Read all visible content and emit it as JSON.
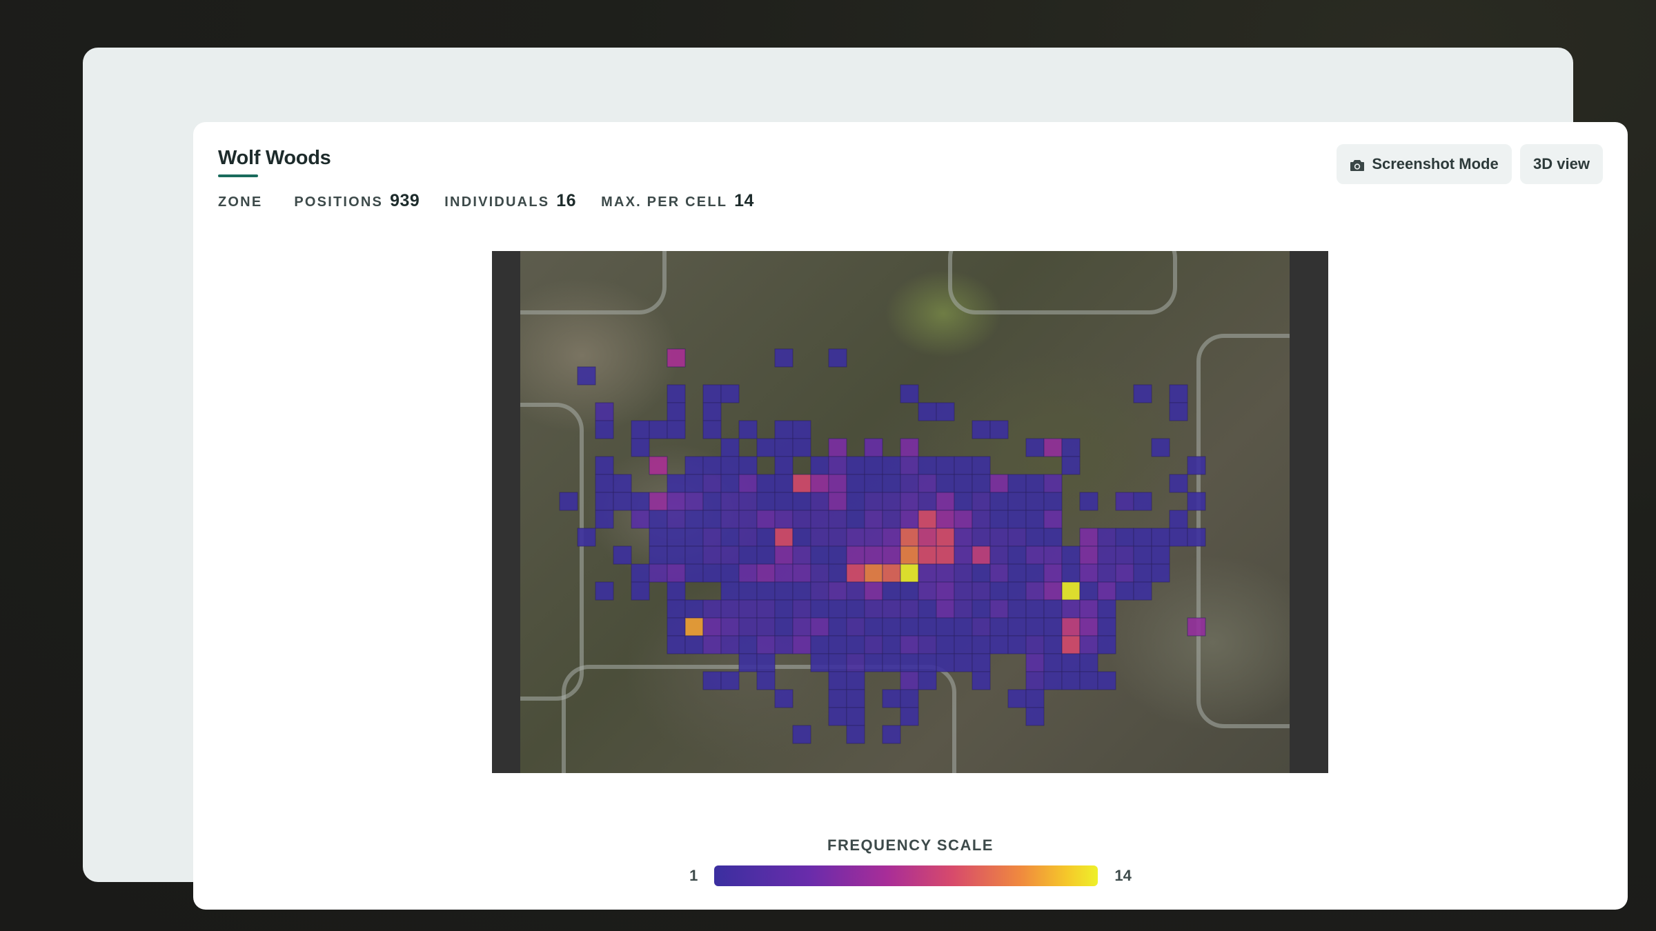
{
  "header": {
    "title": "Wolf Woods",
    "stats": [
      {
        "label": "ZONE",
        "value": ""
      },
      {
        "label": "POSITIONS",
        "value": "939"
      },
      {
        "label": "INDIVIDUALS",
        "value": "16"
      },
      {
        "label": "MAX. PER CELL",
        "value": "14"
      }
    ]
  },
  "toolbar": {
    "screenshot_label": "Screenshot Mode",
    "screenshot_icon": "camera-icon",
    "view3d_label": "3D view"
  },
  "heatmap": {
    "color_min": "#3b2fa0",
    "color_max": "#eef02a",
    "max_value": 14,
    "cells": [
      [
        0,
        0,
        0,
        0,
        0,
        0,
        0,
        0,
        0,
        0,
        0,
        0,
        0,
        0,
        0,
        0,
        0,
        0,
        0,
        0,
        0,
        0,
        0,
        0,
        0,
        0,
        0,
        0,
        0,
        0,
        0,
        0,
        0,
        0,
        0,
        0,
        0,
        0
      ],
      [
        0,
        0,
        0,
        0,
        0,
        0,
        0,
        7,
        0,
        0,
        0,
        0,
        0,
        1,
        0,
        0,
        1,
        0,
        0,
        0,
        0,
        0,
        0,
        0,
        0,
        0,
        0,
        0,
        0,
        0,
        0,
        0,
        0,
        0,
        0,
        0,
        0,
        0
      ],
      [
        0,
        0,
        1,
        0,
        0,
        0,
        0,
        0,
        0,
        0,
        0,
        0,
        0,
        0,
        0,
        0,
        0,
        0,
        0,
        0,
        0,
        0,
        0,
        0,
        0,
        0,
        0,
        0,
        0,
        0,
        0,
        0,
        0,
        0,
        0,
        0,
        0,
        0
      ],
      [
        0,
        0,
        0,
        0,
        0,
        0,
        0,
        1,
        0,
        1,
        1,
        0,
        0,
        0,
        0,
        0,
        0,
        0,
        0,
        0,
        1,
        0,
        0,
        0,
        0,
        0,
        0,
        0,
        0,
        0,
        0,
        0,
        0,
        1,
        0,
        1,
        0,
        0
      ],
      [
        0,
        0,
        0,
        2,
        0,
        0,
        0,
        1,
        0,
        1,
        0,
        0,
        0,
        0,
        0,
        0,
        0,
        0,
        0,
        0,
        0,
        1,
        1,
        0,
        0,
        0,
        0,
        0,
        0,
        0,
        0,
        0,
        0,
        0,
        0,
        1,
        0,
        0
      ],
      [
        0,
        0,
        0,
        1,
        0,
        1,
        1,
        1,
        0,
        1,
        0,
        1,
        0,
        1,
        1,
        0,
        0,
        0,
        0,
        0,
        0,
        0,
        0,
        0,
        1,
        1,
        0,
        0,
        0,
        0,
        0,
        0,
        0,
        0,
        0,
        0,
        0,
        0
      ],
      [
        0,
        0,
        0,
        0,
        0,
        1,
        0,
        0,
        0,
        0,
        1,
        0,
        1,
        1,
        1,
        0,
        5,
        0,
        4,
        0,
        5,
        0,
        0,
        0,
        0,
        0,
        0,
        1,
        6,
        1,
        0,
        0,
        0,
        0,
        1,
        0,
        0,
        0
      ],
      [
        0,
        0,
        0,
        1,
        0,
        0,
        7,
        0,
        1,
        1,
        1,
        1,
        0,
        1,
        0,
        1,
        3,
        1,
        1,
        1,
        3,
        1,
        1,
        1,
        1,
        0,
        0,
        0,
        0,
        1,
        0,
        0,
        0,
        0,
        0,
        0,
        1,
        0
      ],
      [
        0,
        0,
        0,
        1,
        1,
        0,
        0,
        1,
        1,
        2,
        1,
        4,
        1,
        1,
        9,
        6,
        5,
        1,
        1,
        1,
        2,
        3,
        1,
        1,
        1,
        5,
        1,
        1,
        3,
        0,
        0,
        0,
        0,
        0,
        0,
        1,
        0,
        0
      ],
      [
        0,
        1,
        0,
        1,
        1,
        1,
        6,
        4,
        3,
        1,
        2,
        2,
        1,
        1,
        1,
        2,
        5,
        1,
        2,
        2,
        3,
        2,
        5,
        1,
        2,
        1,
        1,
        1,
        1,
        0,
        1,
        0,
        2,
        1,
        0,
        0,
        1,
        0
      ],
      [
        0,
        0,
        0,
        1,
        0,
        3,
        1,
        2,
        1,
        1,
        2,
        2,
        4,
        3,
        2,
        2,
        2,
        1,
        3,
        2,
        4,
        9,
        6,
        5,
        2,
        1,
        1,
        1,
        4,
        0,
        0,
        0,
        0,
        0,
        0,
        1,
        0,
        0
      ],
      [
        0,
        0,
        1,
        0,
        0,
        0,
        1,
        1,
        1,
        2,
        1,
        2,
        1,
        9,
        1,
        2,
        2,
        3,
        3,
        4,
        10,
        8,
        9,
        3,
        2,
        2,
        2,
        1,
        1,
        0,
        5,
        2,
        1,
        1,
        1,
        1,
        1,
        0
      ],
      [
        0,
        0,
        0,
        0,
        1,
        0,
        1,
        1,
        1,
        2,
        2,
        1,
        1,
        5,
        3,
        1,
        1,
        5,
        5,
        5,
        11,
        9,
        9,
        3,
        8,
        2,
        1,
        3,
        3,
        1,
        5,
        2,
        2,
        1,
        1,
        0,
        0,
        0
      ],
      [
        0,
        0,
        0,
        0,
        0,
        1,
        3,
        4,
        1,
        1,
        1,
        4,
        5,
        4,
        4,
        2,
        1,
        9,
        11,
        10,
        14,
        3,
        3,
        2,
        1,
        3,
        1,
        1,
        4,
        1,
        4,
        2,
        3,
        1,
        1,
        0,
        0,
        0
      ],
      [
        0,
        0,
        0,
        1,
        0,
        1,
        0,
        1,
        0,
        0,
        1,
        1,
        1,
        1,
        1,
        2,
        3,
        2,
        5,
        1,
        1,
        3,
        4,
        2,
        2,
        1,
        1,
        3,
        5,
        14,
        1,
        4,
        1,
        1,
        0,
        0,
        0,
        0
      ],
      [
        0,
        0,
        0,
        0,
        0,
        0,
        0,
        1,
        1,
        2,
        2,
        2,
        2,
        1,
        2,
        1,
        1,
        1,
        2,
        2,
        2,
        1,
        4,
        2,
        1,
        3,
        1,
        1,
        1,
        3,
        4,
        1,
        0,
        0,
        0,
        0,
        0,
        0
      ],
      [
        0,
        0,
        0,
        0,
        0,
        0,
        0,
        1,
        12,
        4,
        3,
        2,
        2,
        1,
        3,
        4,
        1,
        2,
        1,
        1,
        1,
        1,
        1,
        1,
        2,
        1,
        1,
        1,
        1,
        8,
        5,
        1,
        0,
        0,
        0,
        0,
        6,
        0
      ],
      [
        0,
        0,
        0,
        0,
        0,
        0,
        0,
        1,
        1,
        3,
        2,
        1,
        3,
        2,
        4,
        1,
        1,
        1,
        2,
        1,
        3,
        2,
        1,
        1,
        1,
        1,
        1,
        2,
        1,
        9,
        3,
        1,
        0,
        0,
        0,
        0,
        0,
        0
      ],
      [
        0,
        0,
        0,
        0,
        0,
        0,
        0,
        0,
        0,
        0,
        0,
        1,
        1,
        0,
        0,
        1,
        1,
        2,
        1,
        1,
        1,
        1,
        1,
        1,
        1,
        0,
        0,
        3,
        1,
        1,
        1,
        0,
        0,
        0,
        0,
        0,
        0,
        0
      ],
      [
        0,
        0,
        0,
        0,
        0,
        0,
        0,
        0,
        0,
        1,
        1,
        0,
        1,
        0,
        0,
        0,
        1,
        1,
        0,
        0,
        3,
        1,
        0,
        0,
        1,
        0,
        0,
        2,
        1,
        1,
        1,
        1,
        0,
        0,
        0,
        0,
        0,
        0
      ],
      [
        0,
        0,
        0,
        0,
        0,
        0,
        0,
        0,
        0,
        0,
        0,
        0,
        0,
        1,
        0,
        0,
        1,
        1,
        0,
        1,
        1,
        0,
        0,
        0,
        0,
        0,
        1,
        1,
        0,
        0,
        0,
        0,
        0,
        0,
        0,
        0,
        0,
        0
      ],
      [
        0,
        0,
        0,
        0,
        0,
        0,
        0,
        0,
        0,
        0,
        0,
        0,
        0,
        0,
        0,
        0,
        1,
        1,
        0,
        0,
        1,
        0,
        0,
        0,
        0,
        0,
        0,
        1,
        0,
        0,
        0,
        0,
        0,
        0,
        0,
        0,
        0,
        0
      ],
      [
        0,
        0,
        0,
        0,
        0,
        0,
        0,
        0,
        0,
        0,
        0,
        0,
        0,
        0,
        1,
        0,
        0,
        1,
        0,
        1,
        0,
        0,
        0,
        0,
        0,
        0,
        0,
        0,
        0,
        0,
        0,
        0,
        0,
        0,
        0,
        0,
        0,
        0
      ]
    ]
  },
  "legend": {
    "title": "FREQUENCY SCALE",
    "min_label": "1",
    "max_label": "14"
  }
}
